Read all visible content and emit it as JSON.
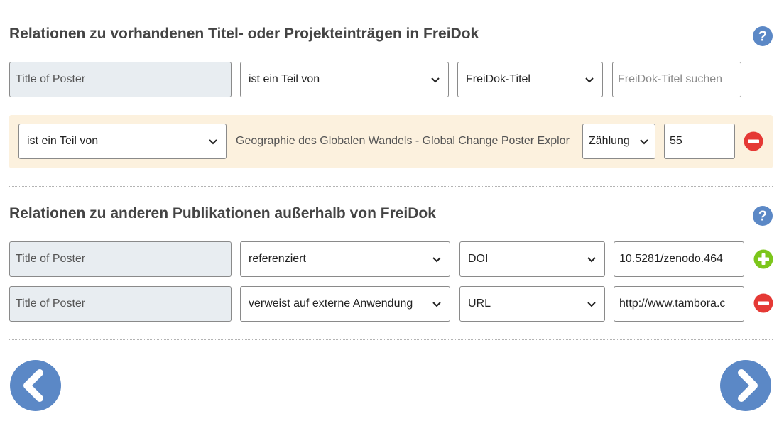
{
  "section1": {
    "title": "Relationen zu vorhandenen Titel- oder Projekteinträgen in FreiDok",
    "new_row": {
      "title_value": "Title of Poster",
      "relation": "ist ein Teil von",
      "target_type": "FreiDok-Titel",
      "search_placeholder": "FreiDok-Titel suchen"
    },
    "existing_row": {
      "relation": "ist ein Teil von",
      "target_title": "Geographie des Globalen Wandels - Global Change Poster Explor",
      "count_type": "Zählung",
      "count_value": "55"
    }
  },
  "section2": {
    "title": "Relationen zu anderen Publikationen außerhalb von FreiDok",
    "rows": [
      {
        "title_value": "Title of Poster",
        "relation": "referenziert",
        "id_type": "DOI",
        "id_value": "10.5281/zenodo.464"
      },
      {
        "title_value": "Title of Poster",
        "relation": "verweist auf externe Anwendung",
        "id_type": "URL",
        "id_value": "http://www.tambora.c"
      }
    ]
  },
  "icons": {
    "help": "question-circle-icon",
    "add": "plus-circle-icon",
    "remove": "minus-circle-icon",
    "prev": "chevron-left-circle-icon",
    "next": "chevron-right-circle-icon",
    "dropdown": "chevron-down-icon"
  },
  "colors": {
    "brand_blue": "#5b88c6",
    "remove_red": "#e53935",
    "add_green": "#7cc61b",
    "highlight_bg": "#fcf1de",
    "readonly_bg": "#e8edf1"
  }
}
